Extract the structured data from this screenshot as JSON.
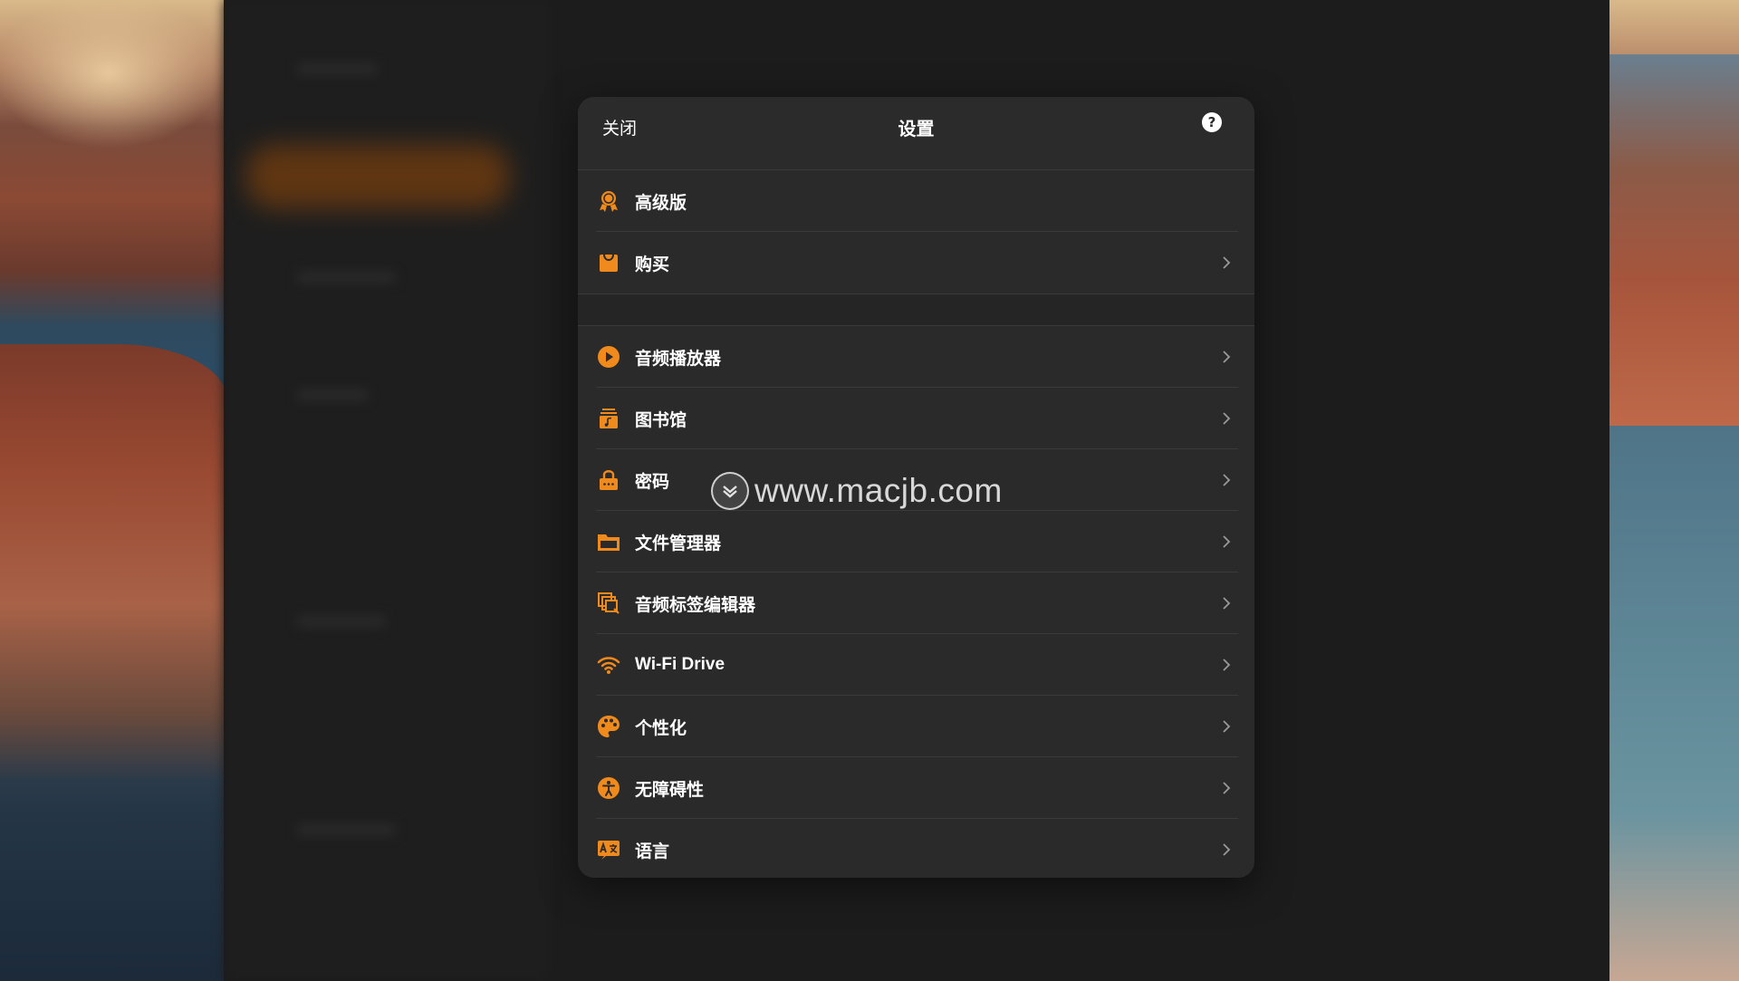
{
  "colors": {
    "accent": "#f08a1c",
    "modal_bg": "#2a2a2a",
    "text": "#ffffff",
    "separator": "#3a3a3a"
  },
  "modal": {
    "close_label": "关闭",
    "title": "设置",
    "help_icon": "question-circle-icon"
  },
  "sections": [
    {
      "items": [
        {
          "label": "高级版",
          "icon": "premium-badge-icon",
          "chevron": false
        },
        {
          "label": "购买",
          "icon": "shopping-bag-icon",
          "chevron": true
        }
      ]
    },
    {
      "items": [
        {
          "label": "音频播放器",
          "icon": "play-circle-icon",
          "chevron": true
        },
        {
          "label": "图书馆",
          "icon": "music-library-icon",
          "chevron": true
        },
        {
          "label": "密码",
          "icon": "lock-icon",
          "chevron": true
        },
        {
          "label": "文件管理器",
          "icon": "folder-icon",
          "chevron": true
        },
        {
          "label": "音频标签编辑器",
          "icon": "tag-editor-icon",
          "chevron": true
        },
        {
          "label": "Wi-Fi Drive",
          "icon": "wifi-icon",
          "chevron": true
        },
        {
          "label": "个性化",
          "icon": "palette-icon",
          "chevron": true
        },
        {
          "label": "无障碍性",
          "icon": "accessibility-icon",
          "chevron": true
        },
        {
          "label": "语言",
          "icon": "translate-icon",
          "chevron": true
        }
      ]
    }
  ],
  "watermark": {
    "text": "www.macjb.com",
    "icon": "macjb-logo-icon"
  }
}
